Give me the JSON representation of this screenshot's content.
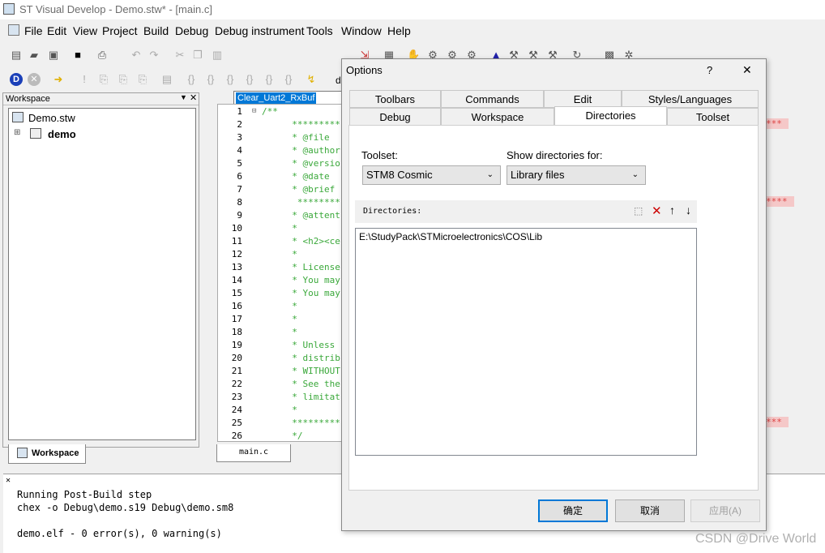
{
  "window": {
    "title": "ST Visual Develop - Demo.stw* - [main.c]"
  },
  "menu": [
    "File",
    "Edit",
    "View",
    "Project",
    "Build",
    "Debug",
    "Debug instrument",
    "Tools",
    "Window",
    "Help"
  ],
  "toolbar": {
    "combo_value": "Clear_Uart2_RxBuf",
    "truncated_label": "d"
  },
  "workspace": {
    "header": "Workspace",
    "root": "Demo.stw",
    "project": "demo",
    "tab_label": "Workspace"
  },
  "editor": {
    "tab_label": "main.c",
    "lines": [
      {
        "n": "1",
        "text": "/**"
      },
      {
        "n": "2",
        "text": "  *********"
      },
      {
        "n": "3",
        "text": "  * @file"
      },
      {
        "n": "4",
        "text": "  * @author"
      },
      {
        "n": "5",
        "text": "  * @versio"
      },
      {
        "n": "6",
        "text": "  * @date"
      },
      {
        "n": "7",
        "text": "  * @brief"
      },
      {
        "n": "8",
        "text": "   ********"
      },
      {
        "n": "9",
        "text": "  * @attent"
      },
      {
        "n": "10",
        "text": "  *"
      },
      {
        "n": "11",
        "text": "  * <h2><ce"
      },
      {
        "n": "12",
        "text": "  *"
      },
      {
        "n": "13",
        "text": "  * License"
      },
      {
        "n": "14",
        "text": "  * You may"
      },
      {
        "n": "15",
        "text": "  * You may"
      },
      {
        "n": "16",
        "text": "  *"
      },
      {
        "n": "17",
        "text": "  *"
      },
      {
        "n": "18",
        "text": "  *"
      },
      {
        "n": "19",
        "text": "  * Unless"
      },
      {
        "n": "20",
        "text": "  * distrib"
      },
      {
        "n": "21",
        "text": "  * WITHOUT"
      },
      {
        "n": "22",
        "text": "  * See the"
      },
      {
        "n": "23",
        "text": "  * limitat"
      },
      {
        "n": "24",
        "text": "  *"
      },
      {
        "n": "25",
        "text": "  *********"
      },
      {
        "n": "26",
        "text": "  */"
      }
    ],
    "right_stars": [
      "***",
      "****",
      "***"
    ]
  },
  "output": {
    "lines": [
      "Running Post-Build step",
      "chex -o Debug\\demo.s19 Debug\\demo.sm8",
      "",
      "demo.elf - 0 error(s), 0 warning(s)"
    ]
  },
  "dialog": {
    "title": "Options",
    "help": "?",
    "close": "✕",
    "tabs_back": [
      "Toolbars",
      "Commands",
      "Edit",
      "Styles/Languages"
    ],
    "tabs_front": [
      "Debug",
      "Workspace",
      "Directories",
      "Toolset"
    ],
    "toolset_label": "Toolset:",
    "toolset_value": "STM8 Cosmic",
    "show_label": "Show directories for:",
    "show_value": "Library files",
    "directories_label": "Directories:",
    "directories": [
      "E:\\StudyPack\\STMicroelectronics\\COS\\Lib"
    ],
    "ok": "确定",
    "cancel": "取消",
    "apply": "应用(A)"
  },
  "watermark": "CSDN @Drive World",
  "colors": {
    "selection": "#0078d7",
    "comment_green": "#3aa83a",
    "accent_blue": "#0078d7"
  }
}
